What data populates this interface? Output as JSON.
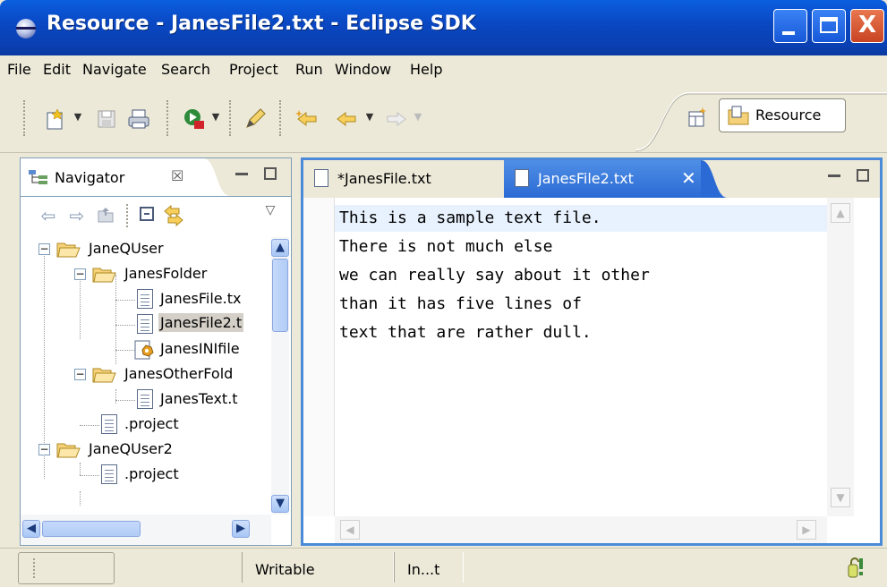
{
  "window": {
    "title": "Resource - JanesFile2.txt - Eclipse SDK",
    "close_glyph": "X"
  },
  "menu": [
    "File",
    "Edit",
    "Navigate",
    "Search",
    "Project",
    "Run",
    "Window",
    "Help"
  ],
  "toolbar": {
    "icons": [
      "new-wizard-icon",
      "save-icon",
      "print-icon",
      "run-debug-icon",
      "marker-pen-icon",
      "last-edit-icon",
      "back-icon",
      "forward-icon"
    ],
    "perspective_label": "Resource"
  },
  "navigator": {
    "tab_label": "Navigator",
    "close_glyph": "☒",
    "tree": [
      {
        "label": "JaneQUser",
        "type": "folder",
        "level": 0,
        "expanded": true
      },
      {
        "label": "JanesFolder",
        "type": "folder",
        "level": 1,
        "expanded": true
      },
      {
        "label": "JanesFile.tx",
        "type": "file",
        "level": 2
      },
      {
        "label": "JanesFile2.t",
        "type": "file",
        "level": 2,
        "selected": true
      },
      {
        "label": "JanesINIfile",
        "type": "ini",
        "level": 2
      },
      {
        "label": "JanesOtherFold",
        "type": "folder",
        "level": 1,
        "expanded": true
      },
      {
        "label": "JanesText.t",
        "type": "file",
        "level": 2
      },
      {
        "label": ".project",
        "type": "file",
        "level": 1
      },
      {
        "label": "JaneQUser2",
        "type": "folder",
        "level": 0,
        "expanded": true
      },
      {
        "label": ".project",
        "type": "file",
        "level": 1
      }
    ]
  },
  "editor": {
    "tabs": [
      {
        "label": "*JanesFile.txt",
        "active": false
      },
      {
        "label": "JanesFile2.txt",
        "active": true
      }
    ],
    "close_glyph": "✕",
    "lines": [
      "This is a sample text file.",
      "There is not much else",
      "we can really say about it other",
      "than it has five lines of",
      "text that are rather dull."
    ]
  },
  "status": {
    "writable": "Writable",
    "insert_mode": "In...t"
  },
  "colors": {
    "title_bar": "#0a48c4",
    "editor_border": "#4a8ad8",
    "active_tab": "#2b6ad4",
    "current_line": "#e8f2fe",
    "selection": "#316ac5"
  }
}
